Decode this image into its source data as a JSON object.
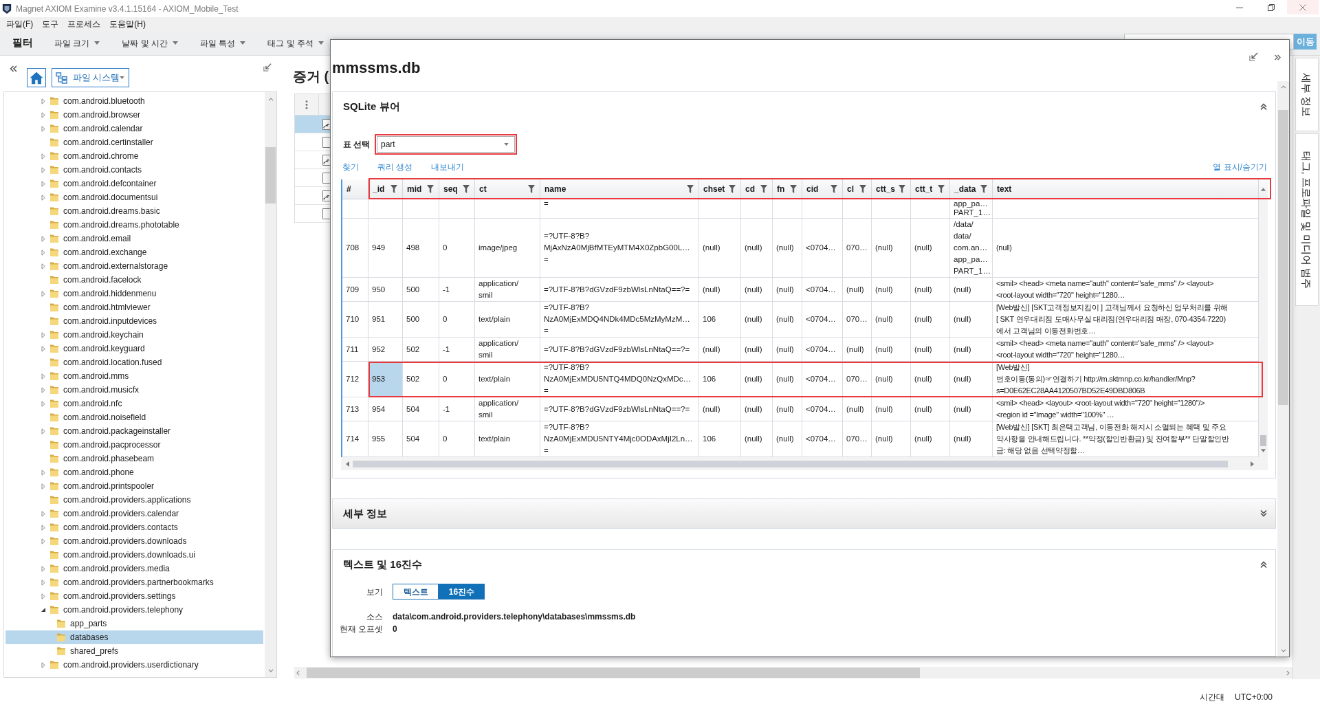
{
  "window": {
    "title": "Magnet AXIOM Examine v3.4.1.15164 - AXIOM_Mobile_Test"
  },
  "menu": [
    "파일(F)",
    "도구",
    "프로세스",
    "도움말(H)"
  ],
  "filter_bar": {
    "title": "필터",
    "filters": [
      "파일 크기",
      "날짜 및 시간",
      "파일 특성",
      "태그 및 주석"
    ],
    "go_button": "이동"
  },
  "explorer": {
    "view": "파일 시스템",
    "tree": [
      {
        "label": "com.android.bluetooth",
        "has_children": true,
        "expanded": false,
        "selected": false
      },
      {
        "label": "com.android.browser",
        "has_children": true,
        "expanded": false,
        "selected": false
      },
      {
        "label": "com.android.calendar",
        "has_children": true,
        "expanded": false,
        "selected": false
      },
      {
        "label": "com.android.certinstaller",
        "has_children": false,
        "expanded": false,
        "selected": false
      },
      {
        "label": "com.android.chrome",
        "has_children": true,
        "expanded": false,
        "selected": false
      },
      {
        "label": "com.android.contacts",
        "has_children": true,
        "expanded": false,
        "selected": false
      },
      {
        "label": "com.android.defcontainer",
        "has_children": true,
        "expanded": false,
        "selected": false
      },
      {
        "label": "com.android.documentsui",
        "has_children": true,
        "expanded": false,
        "selected": false
      },
      {
        "label": "com.android.dreams.basic",
        "has_children": false,
        "expanded": false,
        "selected": false
      },
      {
        "label": "com.android.dreams.phototable",
        "has_children": false,
        "expanded": false,
        "selected": false
      },
      {
        "label": "com.android.email",
        "has_children": true,
        "expanded": false,
        "selected": false
      },
      {
        "label": "com.android.exchange",
        "has_children": true,
        "expanded": false,
        "selected": false
      },
      {
        "label": "com.android.externalstorage",
        "has_children": true,
        "expanded": false,
        "selected": false
      },
      {
        "label": "com.android.facelock",
        "has_children": false,
        "expanded": false,
        "selected": false
      },
      {
        "label": "com.android.hiddenmenu",
        "has_children": true,
        "expanded": false,
        "selected": false
      },
      {
        "label": "com.android.htmlviewer",
        "has_children": false,
        "expanded": false,
        "selected": false
      },
      {
        "label": "com.android.inputdevices",
        "has_children": false,
        "expanded": false,
        "selected": false
      },
      {
        "label": "com.android.keychain",
        "has_children": true,
        "expanded": false,
        "selected": false
      },
      {
        "label": "com.android.keyguard",
        "has_children": true,
        "expanded": false,
        "selected": false
      },
      {
        "label": "com.android.location.fused",
        "has_children": false,
        "expanded": false,
        "selected": false
      },
      {
        "label": "com.android.mms",
        "has_children": true,
        "expanded": false,
        "selected": false
      },
      {
        "label": "com.android.musicfx",
        "has_children": true,
        "expanded": false,
        "selected": false
      },
      {
        "label": "com.android.nfc",
        "has_children": true,
        "expanded": false,
        "selected": false
      },
      {
        "label": "com.android.noisefield",
        "has_children": false,
        "expanded": false,
        "selected": false
      },
      {
        "label": "com.android.packageinstaller",
        "has_children": true,
        "expanded": false,
        "selected": false
      },
      {
        "label": "com.android.pacprocessor",
        "has_children": false,
        "expanded": false,
        "selected": false
      },
      {
        "label": "com.android.phasebeam",
        "has_children": false,
        "expanded": false,
        "selected": false
      },
      {
        "label": "com.android.phone",
        "has_children": true,
        "expanded": false,
        "selected": false
      },
      {
        "label": "com.android.printspooler",
        "has_children": true,
        "expanded": false,
        "selected": false
      },
      {
        "label": "com.android.providers.applications",
        "has_children": false,
        "expanded": false,
        "selected": false
      },
      {
        "label": "com.android.providers.calendar",
        "has_children": true,
        "expanded": false,
        "selected": false
      },
      {
        "label": "com.android.providers.contacts",
        "has_children": true,
        "expanded": false,
        "selected": false
      },
      {
        "label": "com.android.providers.downloads",
        "has_children": true,
        "expanded": false,
        "selected": false
      },
      {
        "label": "com.android.providers.downloads.ui",
        "has_children": false,
        "expanded": false,
        "selected": false
      },
      {
        "label": "com.android.providers.media",
        "has_children": true,
        "expanded": false,
        "selected": false
      },
      {
        "label": "com.android.providers.partnerbookmarks",
        "has_children": true,
        "expanded": false,
        "selected": false
      },
      {
        "label": "com.android.providers.settings",
        "has_children": true,
        "expanded": false,
        "selected": false
      },
      {
        "label": "com.android.providers.telephony",
        "has_children": true,
        "expanded": true,
        "selected": false,
        "children": [
          {
            "label": "app_parts",
            "has_children": false,
            "expanded": false,
            "selected": false
          },
          {
            "label": "databases",
            "has_children": false,
            "expanded": false,
            "selected": true
          },
          {
            "label": "shared_prefs",
            "has_children": false,
            "expanded": false,
            "selected": false
          }
        ]
      },
      {
        "label": "com.android.providers.userdictionary",
        "has_children": true,
        "expanded": false,
        "selected": false
      }
    ]
  },
  "evidence": {
    "title": "증거 (",
    "rows": [
      {
        "kind": "linked",
        "selected": true
      },
      {
        "kind": "plain",
        "selected": false
      },
      {
        "kind": "linked",
        "selected": false
      },
      {
        "kind": "plain",
        "selected": false
      },
      {
        "kind": "linked",
        "selected": false
      },
      {
        "kind": "plain",
        "selected": false
      }
    ]
  },
  "viewer": {
    "title": "mmssms.db",
    "sqlite": {
      "title": "SQLite 뷰어",
      "expanded": true,
      "table_select": {
        "label": "표 선택",
        "value": "part",
        "highlighted": true
      },
      "actions": [
        "찾기",
        "쿼리 생성",
        "내보내기"
      ],
      "column_toggle": "열 표시/숨기기",
      "table": {
        "header_highlighted": true,
        "columns": [
          {
            "label": "#",
            "filter": false
          },
          {
            "label": "_id",
            "filter": true
          },
          {
            "label": "mid",
            "filter": true
          },
          {
            "label": "seq",
            "filter": true
          },
          {
            "label": "ct",
            "filter": true
          },
          {
            "label": "name",
            "filter": true
          },
          {
            "label": "chset",
            "filter": true
          },
          {
            "label": "cd",
            "filter": true
          },
          {
            "label": "fn",
            "filter": true
          },
          {
            "label": "cid",
            "filter": true
          },
          {
            "label": "cl",
            "filter": true
          },
          {
            "label": "ctt_s",
            "filter": true
          },
          {
            "label": "ctt_t",
            "filter": true
          },
          {
            "label": "_data",
            "filter": true
          },
          {
            "label": "text",
            "filter": false
          }
        ],
        "rows": [
          {
            "kind": "cut",
            "selected": false,
            "highlighted": false,
            "cells": [
              null,
              null,
              null,
              null,
              null,
              "=",
              null,
              null,
              null,
              null,
              null,
              null,
              null,
              "app_pa…\nPART_1…",
              null
            ]
          },
          {
            "kind": "full",
            "selected": false,
            "highlighted": false,
            "cells": [
              "708",
              "949",
              "498",
              "0",
              "image/jpeg",
              "=?UTF-8?B?\nMjAxNzA0MjBfMTEyMTM4X0ZpbG00L…\n=",
              "(null)",
              "(null)",
              "(null)",
              "<0704…",
              "070…",
              "(null)",
              "(null)",
              "/data/\ndata/\ncom.an…\napp_pa…\nPART_1…",
              "(null)"
            ]
          },
          {
            "kind": "full",
            "selected": false,
            "highlighted": false,
            "cells": [
              "709",
              "950",
              "500",
              "-1",
              "application/\nsmil",
              "=?UTF-8?B?dGVzdF9zbWlsLnNtaQ==?=",
              "(null)",
              "(null)",
              "(null)",
              "<0704…",
              "(null)",
              "(null)",
              "(null)",
              "(null)",
              "<smil> <head> <meta name=\"auth\" content=\"safe_mms\" /> <layout>\n<root-layout width=\"720\" height=\"1280…"
            ]
          },
          {
            "kind": "full",
            "selected": false,
            "highlighted": false,
            "cells": [
              "710",
              "951",
              "500",
              "0",
              "text/plain",
              "=?UTF-8?B?\nNzA0MjExMDQ4NDk4MDc5MzMyMzM…\n=",
              "106",
              "(null)",
              "(null)",
              "<0704…",
              "070…",
              "(null)",
              "(null)",
              "(null)",
              "[Web발신] [SKT고객정보지킴이 ] 고객님께서 요청하신 업무처리를 위해\n[ SKT 연우대리점 도매사무실 대리점(연우대리점 매장, 070-4354-7220)\n에서 고객님의 이동전화번호…"
            ]
          },
          {
            "kind": "full",
            "selected": false,
            "highlighted": false,
            "cells": [
              "711",
              "952",
              "502",
              "-1",
              "application/\nsmil",
              "=?UTF-8?B?dGVzdF9zbWlsLnNtaQ==?=",
              "(null)",
              "(null)",
              "(null)",
              "<0704…",
              "(null)",
              "(null)",
              "(null)",
              "(null)",
              "<smil> <head> <meta name=\"auth\" content=\"safe_mms\" /> <layout>\n<root-layout width=\"720\" height=\"1280…"
            ]
          },
          {
            "kind": "full",
            "selected": true,
            "highlighted": true,
            "cells": [
              "712",
              "953",
              "502",
              "0",
              "text/plain",
              "=?UTF-8?B?\nNzA0MjExMDU5NTQ4MDQ0NzQxMDc…\n=",
              "106",
              "(null)",
              "(null)",
              "<0704…",
              "070…",
              "(null)",
              "(null)",
              "(null)",
              "[Web발신]\n번호이동(동의)☞연결하기 http://m.sktmnp.co.kr/handler/Mnp?\ns=D0E62EC28AA4120507BD52E49DBD806B"
            ]
          },
          {
            "kind": "full",
            "selected": false,
            "highlighted": false,
            "cells": [
              "713",
              "954",
              "504",
              "-1",
              "application/\nsmil",
              "=?UTF-8?B?dGVzdF9zbWlsLnNtaQ==?=",
              "(null)",
              "(null)",
              "(null)",
              "<0704…",
              "(null)",
              "(null)",
              "(null)",
              "(null)",
              "<smil> <head> <layout> <root-layout width=\"720\" height=\"1280\"/>\n<region id =\"Image\" width=\"100%\" …"
            ]
          },
          {
            "kind": "full",
            "selected": false,
            "highlighted": false,
            "cells": [
              "714",
              "955",
              "504",
              "0",
              "text/plain",
              "=?UTF-8?B?\nNzA0MjExMDU5NTY4Mjc0ODAxMjI2Ln…\n=",
              "106",
              "(null)",
              "(null)",
              "<0704…",
              "070…",
              "(null)",
              "(null)",
              "(null)",
              "[Web발신] [SKT] 최은택고객님, 이동전화 해지시 소멸되는 혜택 및 주요\n약사항을 안내해드립니다. **약정(할인반환금) 및 잔여할부** 단말할인반\n금: 해당 없음 선택약정할…"
            ]
          }
        ]
      }
    },
    "details": {
      "title": "세부 정보",
      "expanded": false
    },
    "text_hex": {
      "title": "텍스트 및 16진수",
      "expanded": true,
      "view_label": "보기",
      "view_options": [
        {
          "label": "텍스트",
          "selected": false
        },
        {
          "label": "16진수",
          "selected": true
        }
      ],
      "fields": [
        {
          "label": "소스",
          "value": "data\\com.android.providers.telephony\\databases\\mmssms.db"
        },
        {
          "label": "현재 오프셋",
          "value": "0"
        }
      ]
    }
  },
  "side_tabs": [
    "세부 정보",
    "태그, 프로파일 및 미디어 범주"
  ],
  "status_bar": {
    "label": "시간대",
    "value": "UTC+0:00"
  }
}
